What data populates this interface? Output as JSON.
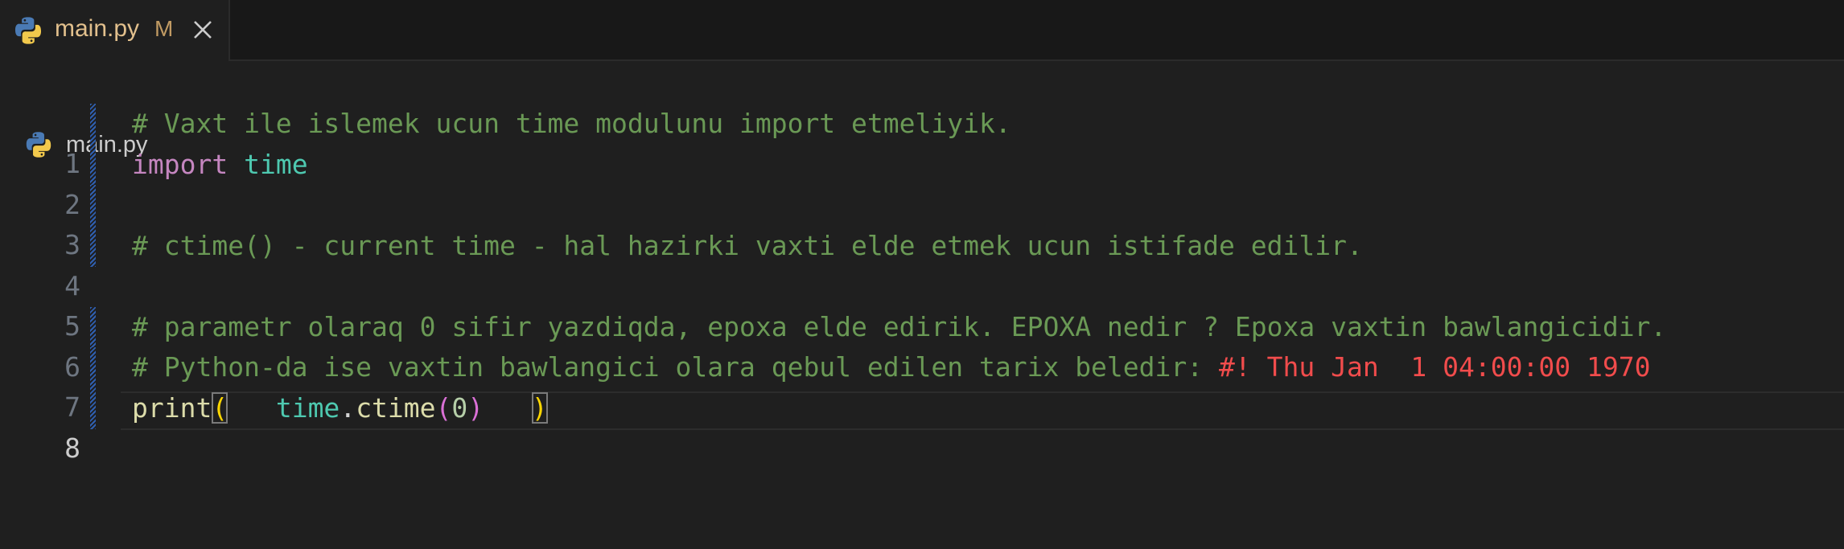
{
  "tab": {
    "filename": "main.py",
    "modified": "M"
  },
  "breadcrumb": {
    "file": "main.py"
  },
  "editor": {
    "lines": [
      {
        "number": "1",
        "comment": "# Vaxt ile islemek ucun time modulunu import etmeliyik."
      },
      {
        "number": "2",
        "keyword": "import",
        "module": "time"
      },
      {
        "number": "3"
      },
      {
        "number": "4",
        "comment": "# ctime() - current time - hal hazirki vaxti elde etmek ucun istifade edilir."
      },
      {
        "number": "5"
      },
      {
        "number": "6",
        "comment": "# parametr olaraq 0 sifir yazdiqda, epoxa elde edirik. EPOXA nedir ? Epoxa vaxtin bawlangicidir."
      },
      {
        "number": "7",
        "comment": "# Python-da ise vaxtin bawlangici olara qebul edilen tarix beledir:",
        "inline_output": "#! Thu Jan  1 04:00:00 1970"
      },
      {
        "number": "8",
        "func": "print",
        "open": "(",
        "object": "time",
        "dot": ".",
        "method": "ctime",
        "inner_open": "(",
        "arg": "0",
        "inner_close": ")",
        "close": ")"
      }
    ]
  },
  "colors": {
    "background": "#1f1f1f",
    "comment": "#6a9955",
    "keyword": "#c586c0",
    "module": "#4ec9b0",
    "function": "#dcdcaa",
    "number": "#b5cea8",
    "output": "#f14c4c",
    "tab_label": "#e2c08d"
  },
  "icons": {
    "tab_file": "python-icon",
    "tab_close": "close-icon",
    "breadcrumb_file": "python-icon"
  }
}
